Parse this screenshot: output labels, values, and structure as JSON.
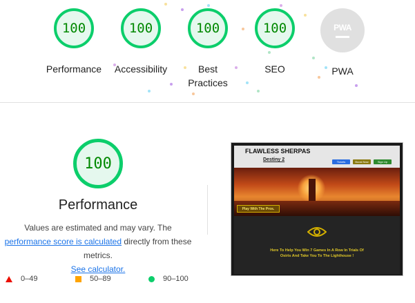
{
  "categories": [
    {
      "id": "performance",
      "score": "100",
      "label": "Performance"
    },
    {
      "id": "accessibility",
      "score": "100",
      "label": "Accessibility"
    },
    {
      "id": "best-practices",
      "score": "100",
      "label": "Best\nPractices"
    },
    {
      "id": "seo",
      "score": "100",
      "label": "SEO"
    },
    {
      "id": "pwa",
      "score": "",
      "label": "PWA",
      "badge": "PWA"
    }
  ],
  "performance_section": {
    "score": "100",
    "title": "Performance",
    "desc_prefix": "Values are estimated and may vary. The ",
    "score_link": "performance score is calculated",
    "desc_middle": " directly from these metrics. ",
    "calc_link": "See calculator."
  },
  "legend": [
    {
      "range": "0–49",
      "shape": "triangle",
      "color": "#eb0f00"
    },
    {
      "range": "50–89",
      "shape": "square",
      "color": "#ffa400"
    },
    {
      "range": "90–100",
      "shape": "circle",
      "color": "#0cce6b"
    }
  ],
  "screenshot": {
    "site_title": "FLAWLESS SHERPAS",
    "site_subtitle": "Destiny 2",
    "nav_buttons": [
      "Tickets",
      "Boost Now",
      "Sign Up"
    ],
    "hero_button": "Play With The Pros.",
    "tagline": "Here To Help You Win 7 Games In A Row In Trials Of Osiris And Take You To The Lighthouse !"
  },
  "colors": {
    "pass": "#0cce6b",
    "pass_text": "#008800",
    "pass_bg": "#e5f8ee",
    "average": "#ffa400",
    "fail": "#eb0f00",
    "link": "#1a73e8"
  }
}
